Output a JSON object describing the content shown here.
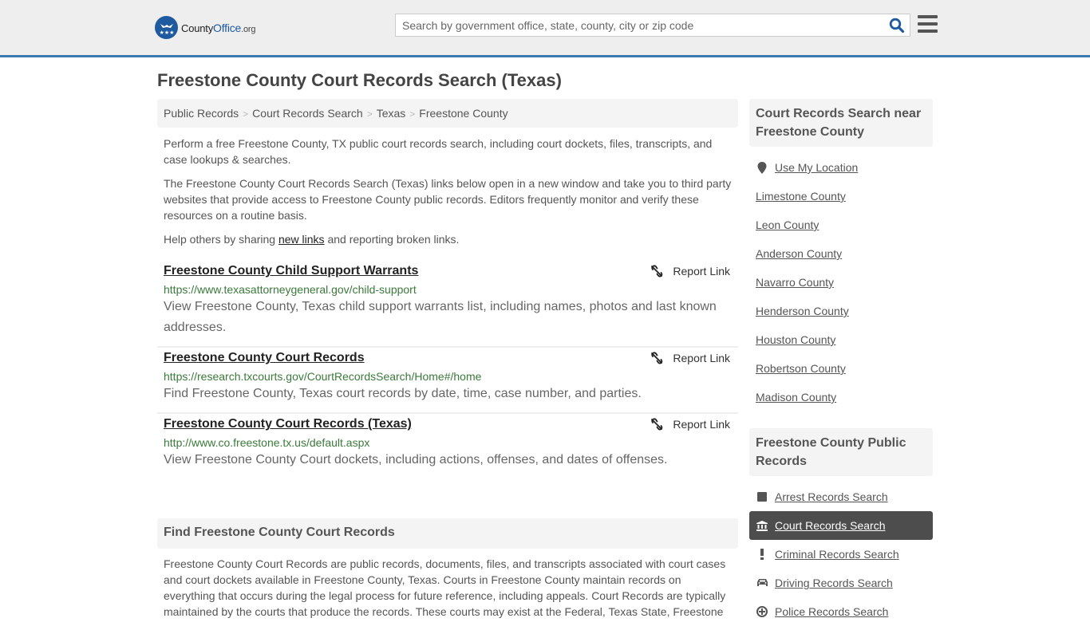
{
  "header": {
    "logo": {
      "county": "County",
      "office": "Office",
      "org": ".org"
    },
    "search": {
      "placeholder": "Search by government office, state, county, city or zip code",
      "value": ""
    }
  },
  "page_title": "Freestone County Court Records Search (Texas)",
  "breadcrumb": [
    "Public Records",
    "Court Records Search",
    "Texas",
    "Freestone County"
  ],
  "intro": {
    "p1": "Perform a free Freestone County, TX public court records search, including court dockets, files, transcripts, and case lookups & searches.",
    "p2": "The Freestone County Court Records Search (Texas) links below open in a new window and take you to third party websites that provide access to Freestone County public records. Editors frequently monitor and verify these resources on a routine basis.",
    "p3_before": "Help others by sharing ",
    "p3_link": "new links",
    "p3_after": " and reporting broken links."
  },
  "results": [
    {
      "title": "Freestone County Child Support Warrants",
      "url": "https://www.texasattorneygeneral.gov/child-support",
      "description": "View Freestone County, Texas child support warrants list, including names, photos and last known addresses.",
      "report_label": "Report Link"
    },
    {
      "title": "Freestone County Court Records",
      "url": "https://research.txcourts.gov/CourtRecordsSearch/Home#/home",
      "description": "Find Freestone County, Texas court records by date, time, case number, and parties.",
      "report_label": "Report Link"
    },
    {
      "title": "Freestone County Court Records (Texas)",
      "url": "http://www.co.freestone.tx.us/default.aspx",
      "description": "View Freestone County Court dockets, including actions, offenses, and dates of offenses.",
      "report_label": "Report Link"
    }
  ],
  "find_section": {
    "heading": "Find Freestone County Court Records",
    "body": "Freestone County Court Records are public records, documents, files, and transcripts associated with court cases and court dockets available in Freestone County, Texas. Courts in Freestone County maintain records on everything that occurs during the legal process for future reference, including appeals. Court Records are typically maintained by the courts that produce the records. These courts may exist at the Federal, Texas State, Freestone"
  },
  "sidebar": {
    "nearby": {
      "heading": "Court Records Search near Freestone County",
      "use_location": "Use My Location",
      "counties": [
        "Limestone County",
        "Leon County",
        "Anderson County",
        "Navarro County",
        "Henderson County",
        "Houston County",
        "Robertson County",
        "Madison County"
      ]
    },
    "public_records": {
      "heading": "Freestone County Public Records",
      "items": [
        {
          "label": "Arrest Records Search",
          "icon": "square-icon",
          "active": false
        },
        {
          "label": "Court Records Search",
          "icon": "courthouse-icon",
          "active": true
        },
        {
          "label": "Criminal Records Search",
          "icon": "exclamation-icon",
          "active": false
        },
        {
          "label": "Driving Records Search",
          "icon": "car-icon",
          "active": false
        },
        {
          "label": "Police Records Search",
          "icon": "police-badge-icon",
          "active": false
        }
      ]
    }
  },
  "colors": {
    "brand": "#1d5aa0",
    "accent_bar": "#3a7ab3",
    "url_green": "#3a7a3a",
    "active_bg": "#4d4d4d"
  }
}
